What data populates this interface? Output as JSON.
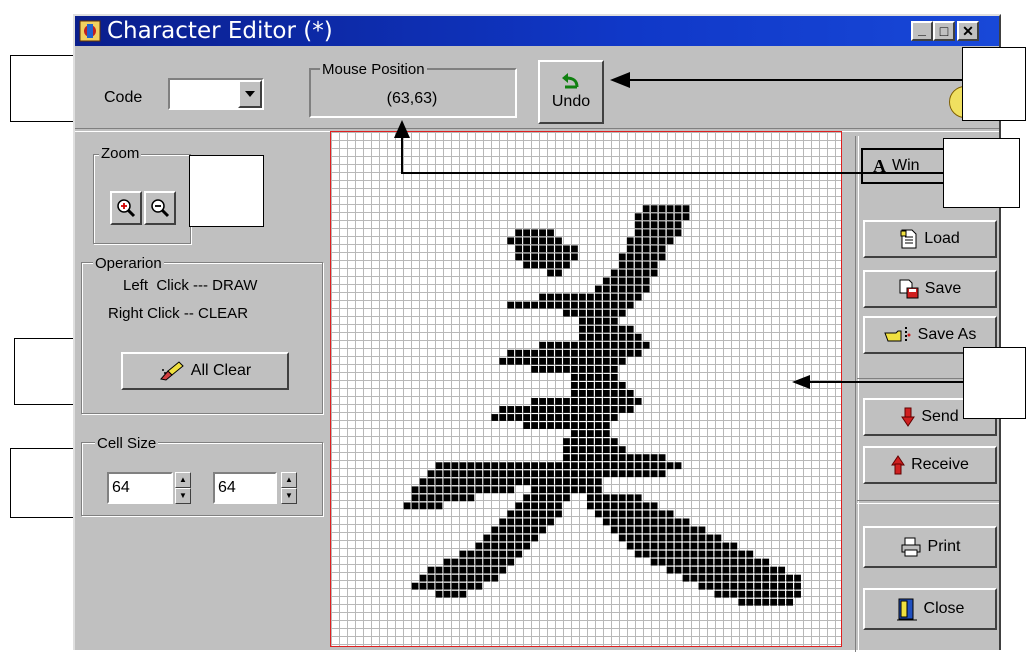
{
  "window": {
    "title": "Character Editor (*)",
    "minimize_label": "_",
    "maximize_label": "□",
    "close_label": "✕"
  },
  "toolbar": {
    "code_label": "Code",
    "code_value": "",
    "mouse_position_label": "Mouse Position",
    "mouse_position_value": "(63,63)",
    "undo_label": "Undo"
  },
  "zoom": {
    "legend": "Zoom"
  },
  "operation": {
    "legend": "Operarion",
    "line1": "Left  Click --- DRAW",
    "line2": "Right Click -- CLEAR",
    "all_clear_label": "All Clear"
  },
  "cell_size": {
    "legend": "Cell Size",
    "width": "64",
    "height": "64"
  },
  "side_buttons": {
    "win_label": "Win",
    "load_label": "Load",
    "save_label": "Save",
    "save_as_label": "Save As",
    "send_label": "Send",
    "receive_label": "Receive",
    "print_label": "Print",
    "close_label": "Close"
  },
  "glyph": {
    "grid_cells": 64,
    "rows": [
      {
        "y": 9,
        "spans": [
          [
            39,
            44
          ]
        ]
      },
      {
        "y": 10,
        "spans": [
          [
            38,
            44
          ]
        ]
      },
      {
        "y": 11,
        "spans": [
          [
            38,
            43
          ]
        ]
      },
      {
        "y": 12,
        "spans": [
          [
            23,
            27
          ],
          [
            38,
            43
          ]
        ]
      },
      {
        "y": 13,
        "spans": [
          [
            22,
            28
          ],
          [
            37,
            42
          ]
        ]
      },
      {
        "y": 14,
        "spans": [
          [
            23,
            30
          ],
          [
            37,
            41
          ]
        ]
      },
      {
        "y": 15,
        "spans": [
          [
            23,
            30
          ],
          [
            36,
            41
          ]
        ]
      },
      {
        "y": 16,
        "spans": [
          [
            24,
            29
          ],
          [
            36,
            40
          ]
        ]
      },
      {
        "y": 17,
        "spans": [
          [
            27,
            28
          ],
          [
            35,
            40
          ]
        ]
      },
      {
        "y": 18,
        "spans": [
          [
            34,
            39
          ]
        ]
      },
      {
        "y": 19,
        "spans": [
          [
            33,
            39
          ]
        ]
      },
      {
        "y": 20,
        "spans": [
          [
            26,
            38
          ]
        ]
      },
      {
        "y": 21,
        "spans": [
          [
            22,
            37
          ]
        ]
      },
      {
        "y": 22,
        "spans": [
          [
            29,
            36
          ]
        ]
      },
      {
        "y": 23,
        "spans": [
          [
            31,
            35
          ]
        ]
      },
      {
        "y": 24,
        "spans": [
          [
            31,
            37
          ]
        ]
      },
      {
        "y": 25,
        "spans": [
          [
            31,
            38
          ]
        ]
      },
      {
        "y": 26,
        "spans": [
          [
            26,
            39
          ]
        ]
      },
      {
        "y": 27,
        "spans": [
          [
            22,
            38
          ]
        ]
      },
      {
        "y": 28,
        "spans": [
          [
            21,
            36
          ]
        ]
      },
      {
        "y": 29,
        "spans": [
          [
            25,
            35
          ]
        ]
      },
      {
        "y": 30,
        "spans": [
          [
            30,
            35
          ]
        ]
      },
      {
        "y": 31,
        "spans": [
          [
            30,
            36
          ]
        ]
      },
      {
        "y": 32,
        "spans": [
          [
            30,
            37
          ]
        ]
      },
      {
        "y": 33,
        "spans": [
          [
            25,
            38
          ]
        ]
      },
      {
        "y": 34,
        "spans": [
          [
            21,
            37
          ]
        ]
      },
      {
        "y": 35,
        "spans": [
          [
            20,
            35
          ]
        ]
      },
      {
        "y": 36,
        "spans": [
          [
            24,
            34
          ]
        ]
      },
      {
        "y": 37,
        "spans": [
          [
            30,
            34
          ]
        ]
      },
      {
        "y": 38,
        "spans": [
          [
            29,
            35
          ]
        ]
      },
      {
        "y": 39,
        "spans": [
          [
            29,
            36
          ]
        ]
      },
      {
        "y": 40,
        "spans": [
          [
            29,
            41
          ]
        ]
      },
      {
        "y": 41,
        "spans": [
          [
            13,
            43
          ]
        ]
      },
      {
        "y": 42,
        "spans": [
          [
            12,
            41
          ]
        ]
      },
      {
        "y": 43,
        "spans": [
          [
            11,
            25
          ],
          [
            26,
            33
          ]
        ]
      },
      {
        "y": 44,
        "spans": [
          [
            10,
            22
          ],
          [
            25,
            33
          ]
        ]
      },
      {
        "y": 45,
        "spans": [
          [
            10,
            17
          ],
          [
            24,
            29
          ],
          [
            32,
            38
          ]
        ]
      },
      {
        "y": 46,
        "spans": [
          [
            9,
            13
          ],
          [
            23,
            28
          ],
          [
            32,
            40
          ]
        ]
      },
      {
        "y": 47,
        "spans": [
          [
            22,
            28
          ],
          [
            33,
            42
          ]
        ]
      },
      {
        "y": 48,
        "spans": [
          [
            21,
            27
          ],
          [
            34,
            44
          ]
        ]
      },
      {
        "y": 49,
        "spans": [
          [
            20,
            26
          ],
          [
            35,
            46
          ]
        ]
      },
      {
        "y": 50,
        "spans": [
          [
            19,
            25
          ],
          [
            36,
            48
          ]
        ]
      },
      {
        "y": 51,
        "spans": [
          [
            18,
            24
          ],
          [
            37,
            50
          ]
        ]
      },
      {
        "y": 52,
        "spans": [
          [
            16,
            23
          ],
          [
            38,
            52
          ]
        ]
      },
      {
        "y": 53,
        "spans": [
          [
            14,
            22
          ],
          [
            40,
            54
          ]
        ]
      },
      {
        "y": 54,
        "spans": [
          [
            12,
            21
          ],
          [
            42,
            56
          ]
        ]
      },
      {
        "y": 55,
        "spans": [
          [
            11,
            20
          ],
          [
            44,
            58
          ]
        ]
      },
      {
        "y": 56,
        "spans": [
          [
            10,
            18
          ],
          [
            46,
            58
          ]
        ]
      },
      {
        "y": 57,
        "spans": [
          [
            13,
            16
          ],
          [
            48,
            58
          ]
        ]
      },
      {
        "y": 58,
        "spans": [
          [
            51,
            57
          ]
        ]
      }
    ]
  }
}
